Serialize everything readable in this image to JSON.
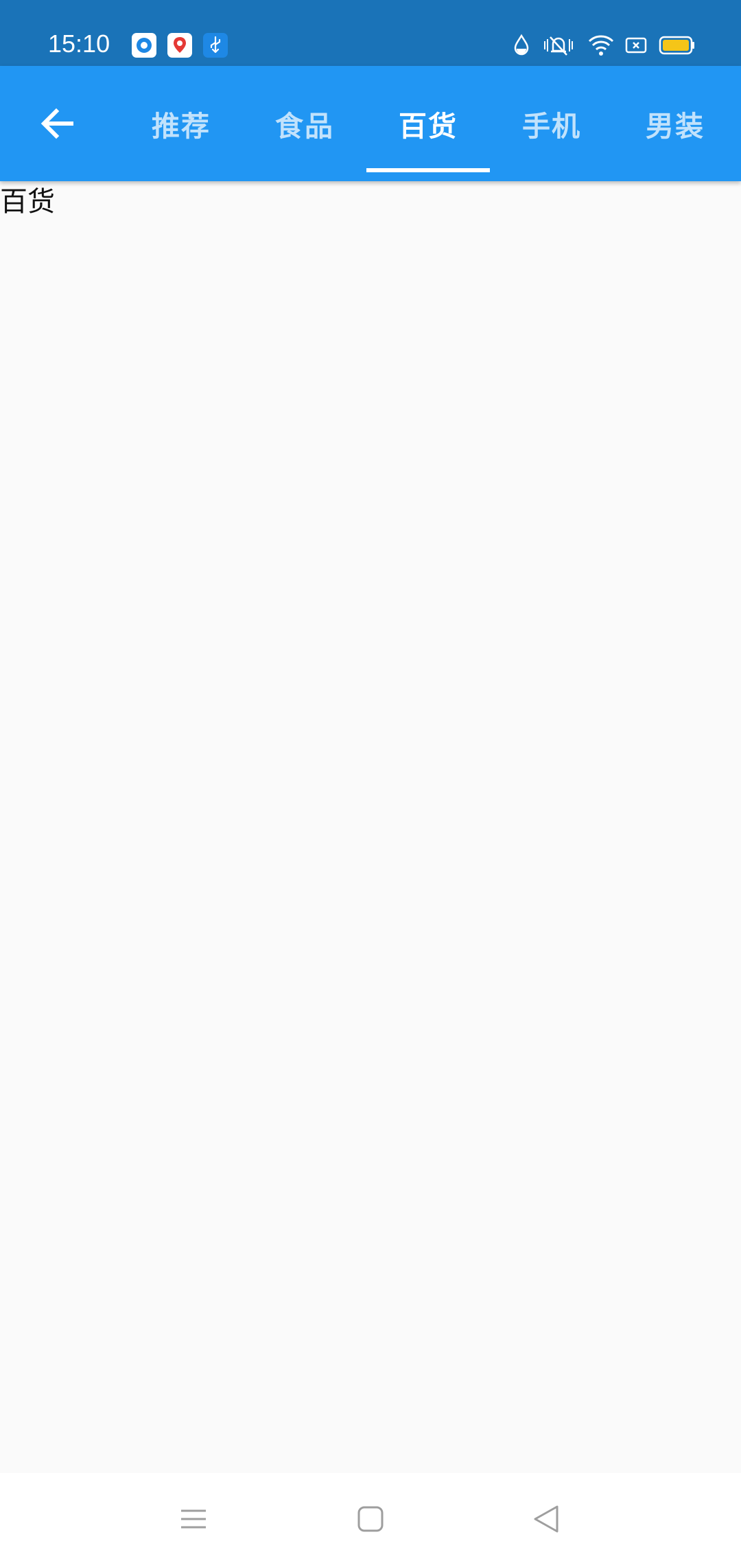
{
  "status_bar": {
    "time": "15:10",
    "background_color": "#1a73b8",
    "notification_icons": [
      "app-circle-icon",
      "map-pin-icon",
      "usb-icon"
    ],
    "right_icons": [
      "water-drop-icon",
      "vibrate-mute-icon",
      "wifi-icon",
      "sim-x-icon",
      "battery-icon"
    ],
    "battery_color": "#f5c518"
  },
  "app_bar": {
    "background_color": "#2196f3",
    "back_icon": "arrow-left-icon",
    "tabs": [
      {
        "label": "推荐",
        "selected": false
      },
      {
        "label": "食品",
        "selected": false
      },
      {
        "label": "百货",
        "selected": true
      },
      {
        "label": "手机",
        "selected": false
      },
      {
        "label": "男装",
        "selected": false
      }
    ]
  },
  "content": {
    "text": "百货"
  },
  "nav_bar": {
    "icons": [
      "menu-icon",
      "home-square-icon",
      "back-triangle-icon"
    ]
  }
}
